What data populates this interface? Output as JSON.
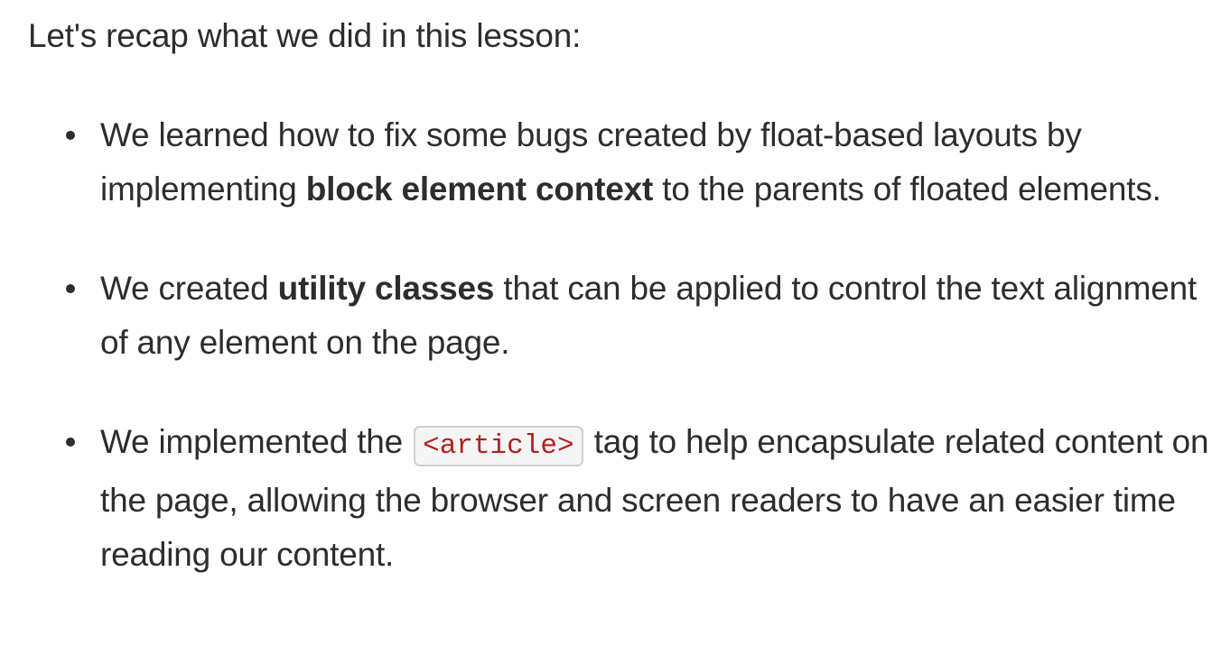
{
  "intro": "Let's recap what we did in this lesson:",
  "items": [
    {
      "before": "We learned how to fix some bugs created by float-based layouts by implementing ",
      "bold": "block element context",
      "after": " to the parents of floated elements."
    },
    {
      "before": "We created ",
      "bold": "utility classes",
      "after": " that can be applied to control the text alignment of any element on the page."
    },
    {
      "before": "We implemented the ",
      "code": "<article>",
      "after": " tag to help encapsulate related content on the page, allowing the browser and screen readers to have an easier time reading our content."
    }
  ],
  "colors": {
    "text": "#2d2d2d",
    "code_text": "#b0221f",
    "code_bg": "#f5f5f5",
    "code_border": "#cfcfcf"
  }
}
